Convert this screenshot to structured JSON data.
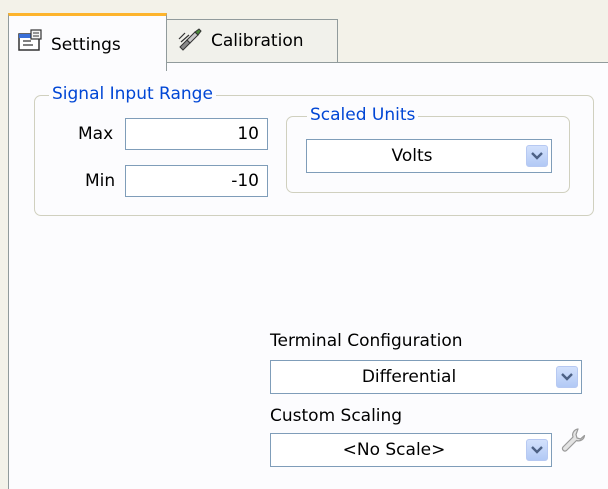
{
  "tabs": {
    "settings": "Settings",
    "calibration": "Calibration"
  },
  "signal_input_range": {
    "title": "Signal Input Range",
    "max_label": "Max",
    "max_value": "10",
    "min_label": "Min",
    "min_value": "-10"
  },
  "scaled_units": {
    "title": "Scaled Units",
    "value": "Volts"
  },
  "terminal_configuration": {
    "label": "Terminal Configuration",
    "value": "Differential"
  },
  "custom_scaling": {
    "label": "Custom Scaling",
    "value": "<No Scale>"
  },
  "colors": {
    "group_title": "#0046d5",
    "active_tab_accent": "#fdb42c"
  },
  "icons": {
    "settings_tab": "settings-dialog-icon",
    "calibration_tab": "calibration-probe-icon",
    "dropdown": "chevron-down-icon",
    "scale_editor": "wrench-icon"
  }
}
